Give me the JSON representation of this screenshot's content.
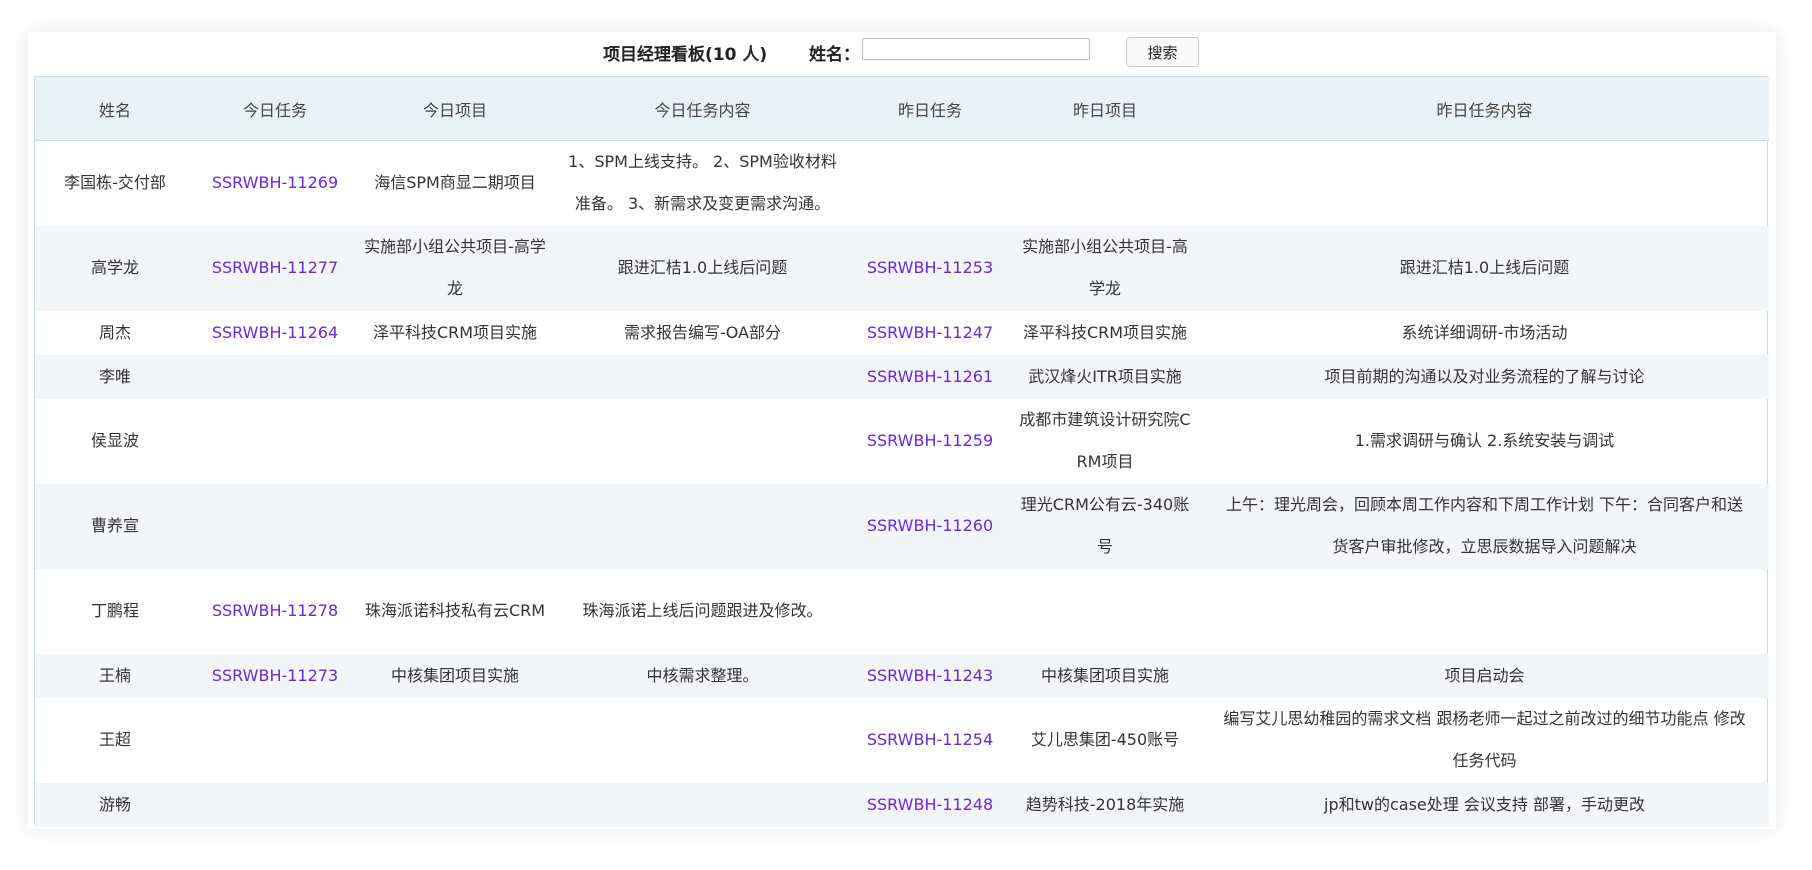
{
  "header": {
    "title": "项目经理看板(10 人)",
    "name_label": "姓名：",
    "search_value": "",
    "search_button": "搜索"
  },
  "colors": {
    "link": "#6a29d6",
    "header_bg": "#e7f1f6",
    "alt_row": "#f3f5f8"
  },
  "table": {
    "columns": [
      "姓名",
      "今日任务",
      "今日项目",
      "今日任务内容",
      "昨日任务",
      "昨日项目",
      "昨日任务内容"
    ],
    "rows": [
      {
        "name": "李国栋-交付部",
        "today_task": "SSRWBH-11269",
        "today_project": "海信SPM商显二期项目",
        "today_content": "1、SPM上线支持。 2、SPM验收材料准备。 3、新需求及变更需求沟通。",
        "yesterday_task": "",
        "yesterday_project": "",
        "yesterday_content": ""
      },
      {
        "name": "高学龙",
        "today_task": "SSRWBH-11277",
        "today_project": "实施部小组公共项目-高学龙",
        "today_content": "跟进汇桔1.0上线后问题",
        "yesterday_task": "SSRWBH-11253",
        "yesterday_project": "实施部小组公共项目-高学龙",
        "yesterday_content": "跟进汇桔1.0上线后问题"
      },
      {
        "name": "周杰",
        "today_task": "SSRWBH-11264",
        "today_project": "泽平科技CRM项目实施",
        "today_content": "需求报告编写-OA部分",
        "yesterday_task": "SSRWBH-11247",
        "yesterday_project": "泽平科技CRM项目实施",
        "yesterday_content": "系统详细调研-市场活动"
      },
      {
        "name": "李唯",
        "today_task": "",
        "today_project": "",
        "today_content": "",
        "yesterday_task": "SSRWBH-11261",
        "yesterday_project": "武汉烽火ITR项目实施",
        "yesterday_content": "项目前期的沟通以及对业务流程的了解与讨论"
      },
      {
        "name": "侯显波",
        "today_task": "",
        "today_project": "",
        "today_content": "",
        "yesterday_task": "SSRWBH-11259",
        "yesterday_project": "成都市建筑设计研究院CRM项目",
        "yesterday_content": "1.需求调研与确认 2.系统安装与调试"
      },
      {
        "name": "曹养宣",
        "today_task": "",
        "today_project": "",
        "today_content": "",
        "yesterday_task": "SSRWBH-11260",
        "yesterday_project": "理光CRM公有云-340账号",
        "yesterday_content": "上午：理光周会，回顾本周工作内容和下周工作计划 下午：合同客户和送货客户审批修改，立思辰数据导入问题解决"
      },
      {
        "name": "丁鹏程",
        "today_task": "SSRWBH-11278",
        "today_project": "珠海派诺科技私有云CRM",
        "today_content": "珠海派诺上线后问题跟进及修改。",
        "yesterday_task": "",
        "yesterday_project": "",
        "yesterday_content": ""
      },
      {
        "name": "王楠",
        "today_task": "SSRWBH-11273",
        "today_project": "中核集团项目实施",
        "today_content": "中核需求整理。",
        "yesterday_task": "SSRWBH-11243",
        "yesterday_project": "中核集团项目实施",
        "yesterday_content": "项目启动会"
      },
      {
        "name": "王超",
        "today_task": "",
        "today_project": "",
        "today_content": "",
        "yesterday_task": "SSRWBH-11254",
        "yesterday_project": "艾儿思集团-450账号",
        "yesterday_content": "编写艾儿思幼稚园的需求文档 跟杨老师一起过之前改过的细节功能点 修改任务代码"
      },
      {
        "name": "游畅",
        "today_task": "",
        "today_project": "",
        "today_content": "",
        "yesterday_task": "SSRWBH-11248",
        "yesterday_project": "趋势科技-2018年实施",
        "yesterday_content": "jp和tw的case处理 会议支持 部署，手动更改"
      }
    ]
  }
}
